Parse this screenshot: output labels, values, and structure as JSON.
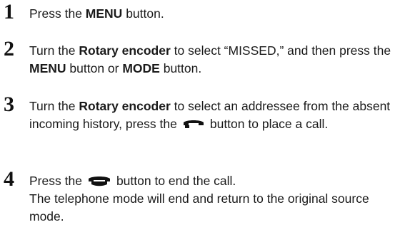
{
  "steps": [
    {
      "number": "1",
      "text_a": "Press the ",
      "bold_a": "MENU",
      "text_b": " button."
    },
    {
      "number": "2",
      "text_a": "Turn the ",
      "bold_a": "Rotary encoder",
      "text_b": " to select “MISSED,” and then press the ",
      "bold_b": "MENU",
      "text_c": " button or ",
      "bold_c": "MODE",
      "text_d": " button."
    },
    {
      "number": "3",
      "text_a": "Turn the ",
      "bold_a": "Rotary encoder",
      "text_b": " to select an addressee from the absent incoming history, press the",
      "icon": "phone-offhook-icon",
      "text_c": "button to place a call."
    },
    {
      "number": "4",
      "text_a": "Press the",
      "icon": "phone-onhook-icon",
      "text_b": "button to end the call.",
      "text_c": "The telephone mode will end and return to the original source mode."
    }
  ]
}
